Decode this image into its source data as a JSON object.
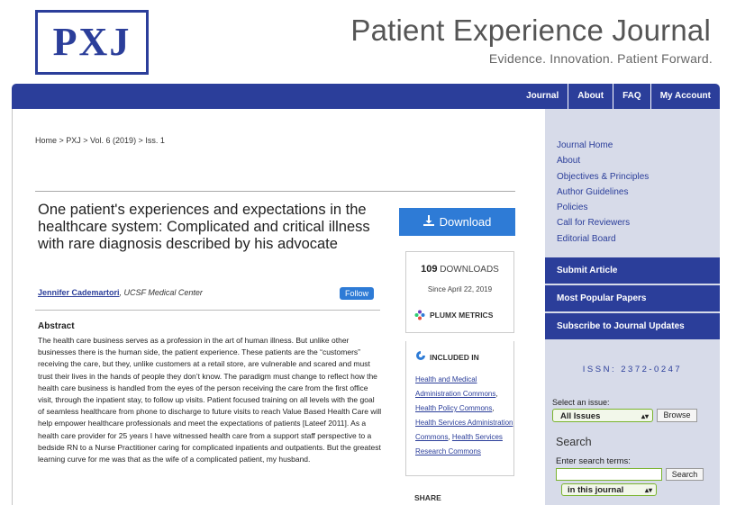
{
  "header": {
    "logo_text": "PXJ",
    "site_title": "Patient Experience Journal",
    "tagline": "Evidence. Innovation. Patient Forward."
  },
  "nav": [
    "Journal",
    "About",
    "FAQ",
    "My Account"
  ],
  "breadcrumb": "Home > PXJ > Vol. 6 (2019) > Iss. 1",
  "article": {
    "title": "One patient's experiences and expectations in the healthcare system: Complicated and critical illness with rare diagnosis described by his advocate",
    "author": "Jennifer Cademartori",
    "institution": ", UCSF Medical Center",
    "follow_label": "Follow",
    "abstract_heading": "Abstract",
    "abstract_text": "The health care business serves as a profession in the art of human illness. But unlike other businesses there is the human side, the patient experience. These patients are the “customers” receiving the care, but they, unlike customers at a retail store, are vulnerable and scared and must trust their lives in the hands of people they don’t know. The paradigm must change to reflect how the health care business is handled from the eyes of the person receiving the care from the first office visit, through the inpatient stay, to follow up visits. Patient focused training on all levels with the goal of seamless healthcare from phone to discharge to future visits to reach Value Based Health Care will help empower healthcare professionals and meet the expectations of patients [Lateef 2011]. As a health care provider for 25 years I have witnessed health care from a support staff perspective to a bedside RN to a Nurse Practitioner caring for complicated inpatients and outpatients. But the greatest learning curve for me was that as the wife of a complicated patient, my husband."
  },
  "metrics": {
    "download_label": "Download",
    "download_count": "109",
    "downloads_label": "DOWNLOADS",
    "since": "Since April 22, 2019",
    "plumx_label": "PLUMX METRICS",
    "included_heading": "INCLUDED IN",
    "included_links": [
      "Health and Medical Administration Commons",
      "Health Policy Commons",
      "Health Services Administration Commons",
      "Health Services Research Commons"
    ],
    "share_heading": "SHARE"
  },
  "sidebar": {
    "links": [
      "Journal Home",
      "About",
      "Objectives & Principles",
      "Author Guidelines",
      "Policies",
      "Call for Reviewers",
      "Editorial Board"
    ],
    "buttons": [
      "Submit Article",
      "Most Popular Papers",
      "Subscribe to Journal Updates"
    ],
    "issn": "ISSN: 2372-0247",
    "select_issue_label": "Select an issue:",
    "select_issue_value": "All Issues",
    "browse_label": "Browse",
    "search_heading": "Search",
    "search_label": "Enter search terms:",
    "search_value": "",
    "search_button": "Search",
    "scope_value": "in this journal"
  },
  "colors": {
    "brand": "#2b3e9a",
    "download": "#2e7bd6",
    "sidebar_bg": "#d7dbe9",
    "select_border": "#7ab32e"
  }
}
